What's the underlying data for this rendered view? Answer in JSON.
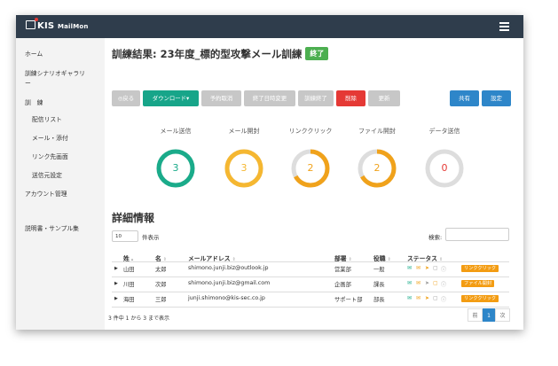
{
  "app": {
    "brand": "KIS",
    "brand_sub": "MailMon"
  },
  "sidebar": {
    "items": [
      {
        "label": "ホーム"
      },
      {
        "label": "訓練シナリオギャラリ"
      },
      {
        "label": "ー"
      },
      {
        "label": "訓　練"
      },
      {
        "label": "配信リスト"
      },
      {
        "label": "メール・添付"
      },
      {
        "label": "リンク先画面"
      },
      {
        "label": "送信元設定"
      },
      {
        "label": "アカウント管理"
      },
      {
        "label": "説明書・サンプル集"
      }
    ]
  },
  "page": {
    "title": "訓練結果: 23年度_標的型攻撃メール訓練",
    "status_badge": "終了"
  },
  "toolbar": {
    "back": "◎戻る",
    "download": "ダウンロード▾",
    "cancel_schedule": "予約取消",
    "change_end_date": "終了日時変更",
    "end_training": "訓練終了",
    "delete": "削除",
    "update": "更新",
    "share": "共有",
    "settings": "設定"
  },
  "stats": [
    {
      "label": "メール送信",
      "value": "3",
      "color": "#1aab8a",
      "ratio": 1.0
    },
    {
      "label": "メール開封",
      "value": "3",
      "color": "#f5b731",
      "ratio": 1.0
    },
    {
      "label": "リンククリック",
      "value": "2",
      "color": "#f0a21b",
      "ratio": 0.67
    },
    {
      "label": "ファイル開封",
      "value": "2",
      "color": "#f0a21b",
      "ratio": 0.67
    },
    {
      "label": "データ送信",
      "value": "0",
      "color": "#e53935",
      "ratio": 0.0
    }
  ],
  "details": {
    "heading": "詳細情報",
    "per_page_value": "10",
    "per_page_label": "件表示",
    "search_label": "検索:",
    "columns": [
      "姓",
      "名",
      "メールアドレス",
      "部署",
      "役職",
      "ステータス"
    ],
    "rows": [
      {
        "last": "山田",
        "first": "太郎",
        "email": "shimono.junji.biz@outlook.jp",
        "dept": "営業部",
        "title": "一般",
        "tag": "リンククリック"
      },
      {
        "last": "川田",
        "first": "次郎",
        "email": "shimono.junji.biz@gmail.com",
        "dept": "企画部",
        "title": "課長",
        "tag": "ファイル開封"
      },
      {
        "last": "海田",
        "first": "三郎",
        "email": "junji.shimono@kis-sec.co.jp",
        "dept": "サポート部",
        "title": "部長",
        "tag": "リンククリック"
      }
    ],
    "info": "3 件中 1 から 3 まで表示",
    "pager": {
      "prev": "前",
      "page": "1",
      "next": "次"
    }
  },
  "colors": {
    "topbar": "#2f3d4c",
    "accent": "#2e86c9",
    "success": "#4caf50",
    "tag": "#f39c12"
  }
}
